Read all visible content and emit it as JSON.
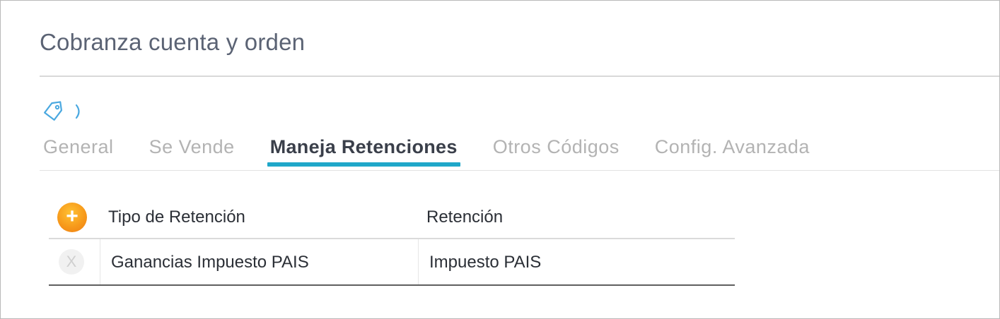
{
  "header": {
    "title": "Cobranza cuenta y orden"
  },
  "breadcrumb": {
    "icon": "tag-icon",
    "separator_icon": "chevron-right-icon",
    "accent_color": "#4aa8e0"
  },
  "tabs": [
    {
      "label": "General",
      "active": false
    },
    {
      "label": "Se Vende",
      "active": false
    },
    {
      "label": "Maneja Retenciones",
      "active": true
    },
    {
      "label": "Otros Códigos",
      "active": false
    },
    {
      "label": "Config. Avanzada",
      "active": false
    }
  ],
  "tab_indicator_color": "#1fa7c9",
  "grid": {
    "add_button_icon": "plus-icon",
    "add_button_glyph": "+",
    "add_button_color": "#f79a1b",
    "columns": [
      "Tipo de Retención",
      "Retención"
    ],
    "rows": [
      {
        "delete_glyph": "X",
        "tipo_retencion": "Ganancias Impuesto PAIS",
        "retencion": "Impuesto PAIS"
      }
    ]
  }
}
